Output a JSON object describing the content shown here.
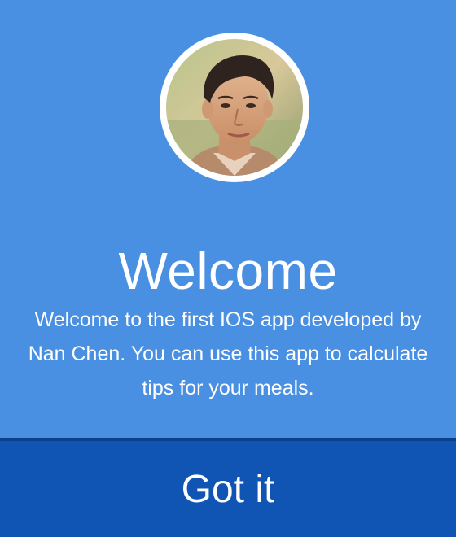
{
  "welcome": {
    "title": "Welcome",
    "message": "Welcome to the first IOS app developed by Nan Chen. You can use this app to calculate tips for your meals.",
    "button_label": "Got it"
  },
  "colors": {
    "background": "#4a90e2",
    "button_background": "#1055b3",
    "text": "#ffffff"
  }
}
